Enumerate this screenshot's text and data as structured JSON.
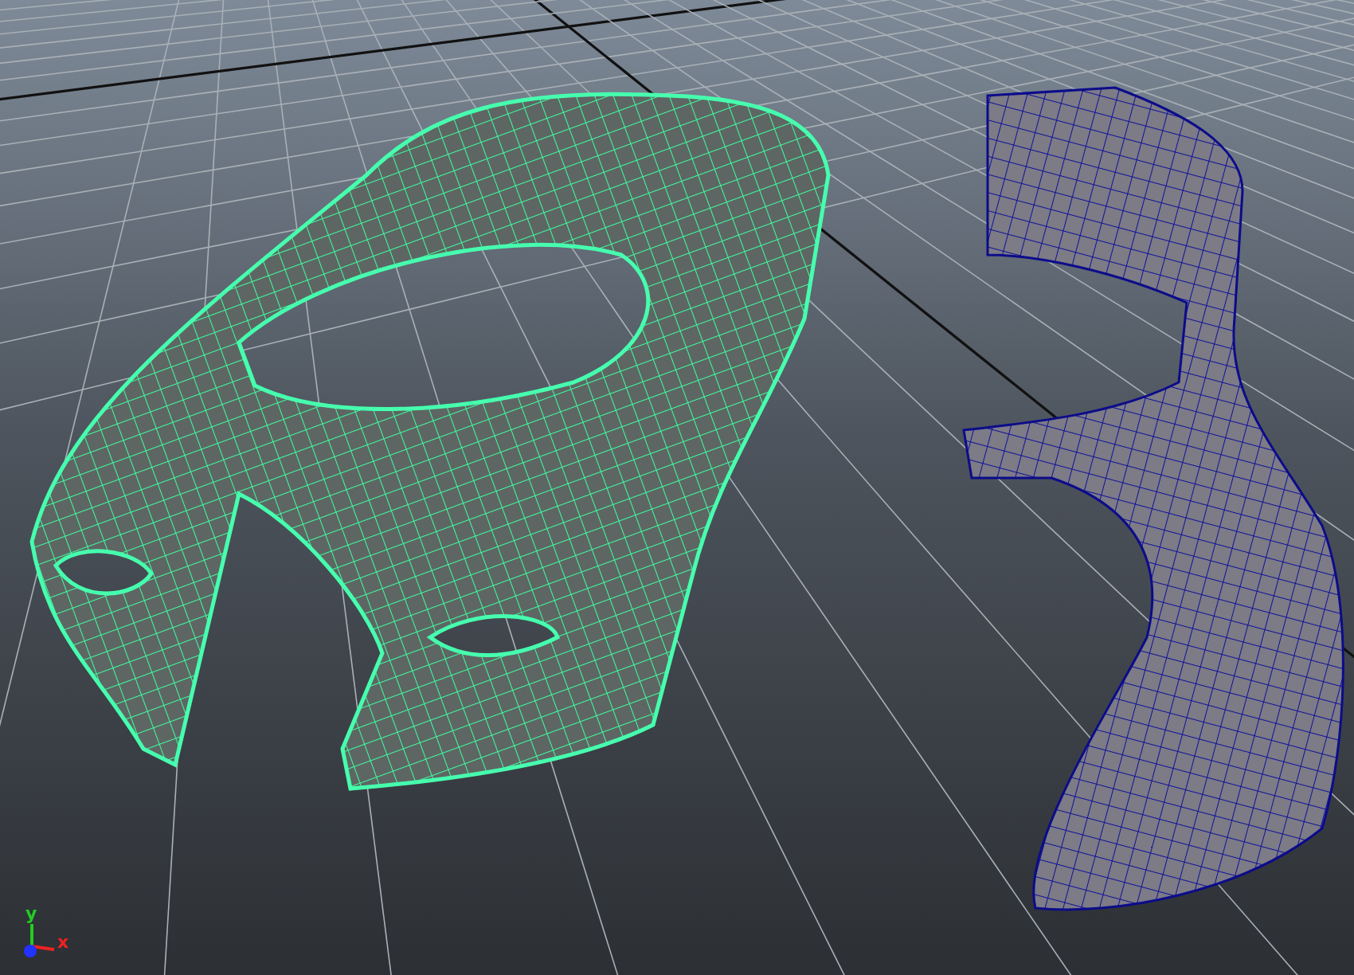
{
  "viewport": {
    "meshes": [
      {
        "kind": "car-body",
        "selected": true
      },
      {
        "kind": "bumper",
        "selected": false
      }
    ],
    "axis_labels": [
      {
        "label": "y",
        "color": "#22cc22"
      },
      {
        "label": "x",
        "color": "#ee2222"
      }
    ]
  }
}
